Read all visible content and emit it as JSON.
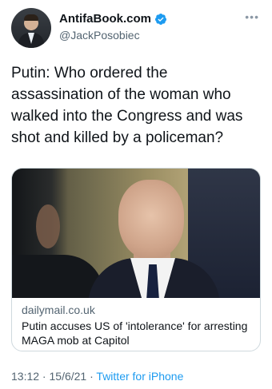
{
  "author": {
    "display_name": "AntifaBook.com",
    "handle": "@JackPosobiec",
    "verified_icon": "verified-badge-icon",
    "verified_color": "#1d9bf0"
  },
  "more_menu_icon": "more-icon",
  "tweet": {
    "text": "Putin: Who ordered the assassination of the woman who walked into the Congress and was shot and killed by a policeman?"
  },
  "card": {
    "domain": "dailymail.co.uk",
    "title": "Putin accuses US of 'intolerance' for arresting MAGA mob at Capitol"
  },
  "meta": {
    "time": "13:12",
    "separator1": " · ",
    "date": "15/6/21",
    "separator2": " · ",
    "source": "Twitter for iPhone"
  }
}
